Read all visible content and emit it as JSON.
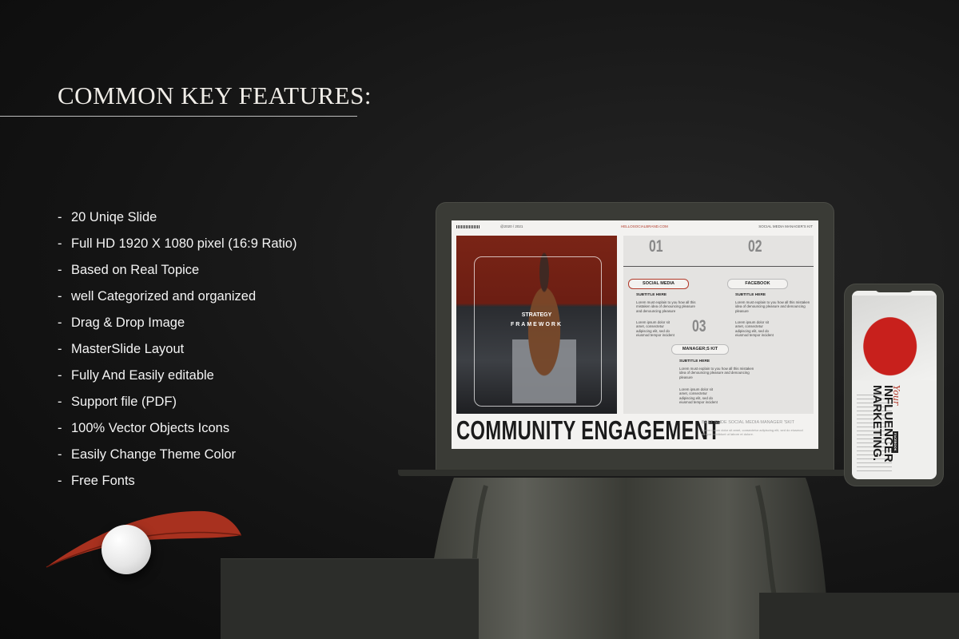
{
  "heading": "COMMON KEY FEATURES:",
  "features": [
    "20 Uniqe Slide",
    "Full HD 1920 X 1080 pixel (16:9 Ratio)",
    "Based on Real Topice",
    "well Categorized and organized",
    "Drag & Drop Image",
    "MasterSlide Layout",
    "Fully And Easily editable",
    "Support file (PDF)",
    "100% Vector Objects Icons",
    "Easily Change Theme Color",
    "Free Fonts"
  ],
  "laptop_slide": {
    "date": "@2020 / 2021",
    "email": "HELLOSOCIALBRAND.COM",
    "kit": "SOCIAL MEDIA MANAGER'S KIT",
    "photo_text_1": "STRATEGY",
    "photo_text_2": "FRAMEWORK",
    "num_1": "01",
    "num_2": "02",
    "num_3": "03",
    "pill_1": "SOCIAL MEDIA",
    "pill_2": "FACEBOOK",
    "pill_3": "MANAGER;S KIT",
    "subtitle": "SUBTITLE HERE",
    "body_1": "Lorem must explain to you how all this mistaken idea of denouncing pleasure and denouncing pleasure",
    "body_2": "Lorem ipsum dolor sit amet, consectetur adipiscing elit, sed do eiusmod tempor incident",
    "title": "COMMUNITY ENGAGEMENT",
    "best_slide": "BEST SLIDE SOCIAL MEDIA MANAGER 'SKIT",
    "best_slide_text": "Lorem ipsum dolor sit amet, consectetur adipiscing elit, sed do eiusmod tempor incididunt ut labore et dolore."
  },
  "phone_slide": {
    "title_line_1": "INFLUENCER",
    "title_line_2": "MARKETING.",
    "script": "Your",
    "label": "FACEBOOK"
  },
  "colors": {
    "background": "#141414",
    "accent": "#b23a2a",
    "device": "#3a3b36"
  }
}
